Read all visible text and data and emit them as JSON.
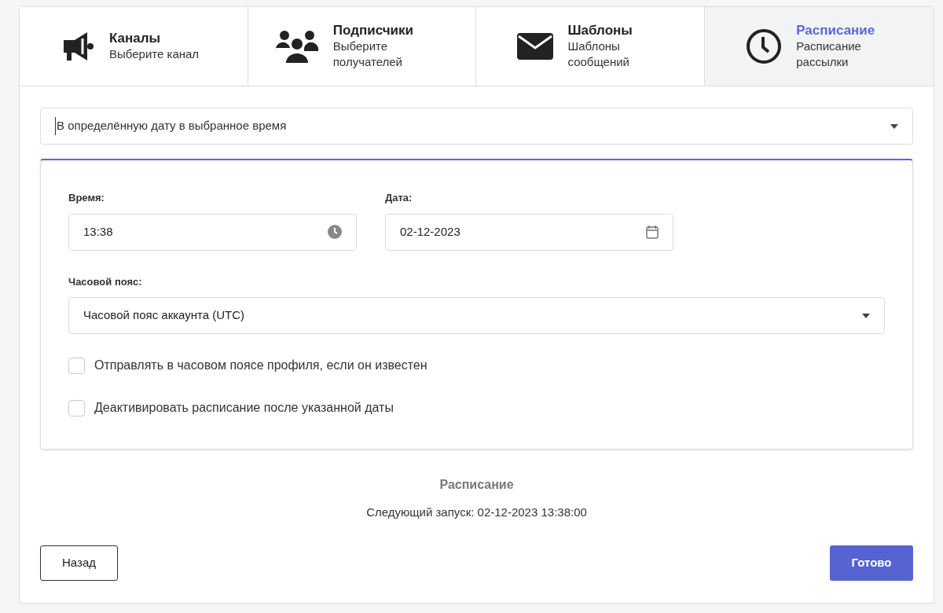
{
  "steps": [
    {
      "kind": "megaphone",
      "title": "Каналы",
      "subtitle": "Выберите канал",
      "selected": false
    },
    {
      "kind": "users",
      "title": "Подписчики",
      "subtitle": "Выберите получателей",
      "selected": false
    },
    {
      "kind": "envelope",
      "title": "Шаблоны",
      "subtitle": "Шаблоны сообщений",
      "selected": false
    },
    {
      "kind": "clock",
      "title": "Расписание",
      "subtitle": "Расписание рассылки",
      "selected": true
    }
  ],
  "schedule_type": {
    "value": "В определённую дату в выбранное время"
  },
  "time": {
    "label": "Время:",
    "value": "13:38"
  },
  "date": {
    "label": "Дата:",
    "value": "02-12-2023"
  },
  "timezone": {
    "label": "Часовой пояс:",
    "value": "Часовой пояс аккаунта (UTC)"
  },
  "options": [
    {
      "label": "Отправлять в часовом поясе профиля, если он известен",
      "checked": false
    },
    {
      "label": "Деактивировать расписание после указанной даты",
      "checked": false
    }
  ],
  "summary": {
    "title": "Расписание",
    "next_run": "Следующий запуск: 02-12-2023 13:38:00"
  },
  "buttons": {
    "back": "Назад",
    "done": "Готово"
  }
}
